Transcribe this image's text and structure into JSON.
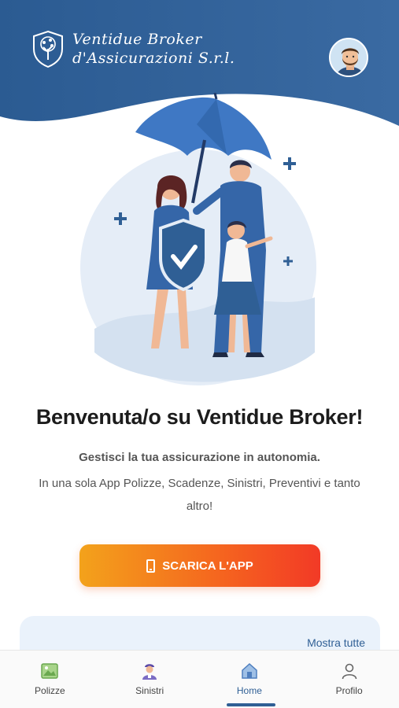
{
  "header": {
    "logo_line1": "Ventidue Broker",
    "logo_line2": "d'Assicurazioni S.r.l.",
    "bg_color": "#2f5f95"
  },
  "avatar": {
    "icon": "user-avatar"
  },
  "hero": {
    "icon": "family-insurance-illustration"
  },
  "welcome": {
    "title": "Benvenuta/o su Ventidue Broker!",
    "subtitle": "Gestisci la tua assicurazione in autonomia.",
    "description": "In una sola App Polizze, Scadenze, Sinistri, Preventivi e tanto altro!"
  },
  "cta": {
    "label": "SCARICA L'APP",
    "icon": "phone-icon"
  },
  "card": {
    "more_label": "Mostra tutte"
  },
  "tabbar": {
    "items": [
      {
        "label": "Polizze",
        "icon": "image-icon"
      },
      {
        "label": "Sinistri",
        "icon": "agent-icon"
      },
      {
        "label": "Home",
        "icon": "home-icon",
        "active": true
      },
      {
        "label": "Profilo",
        "icon": "user-icon"
      }
    ]
  }
}
